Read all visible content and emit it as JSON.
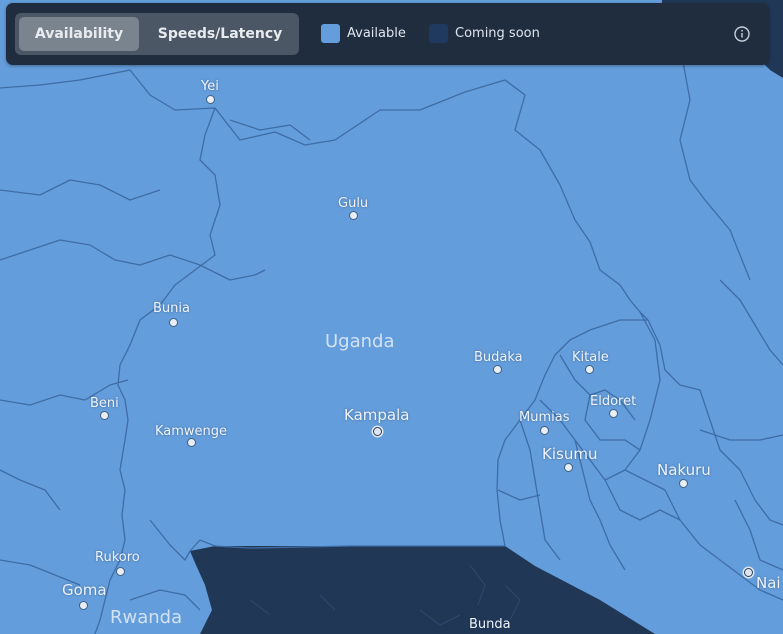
{
  "toolbar": {
    "tabs": [
      {
        "label": "Availability",
        "active": true
      },
      {
        "label": "Speeds/Latency",
        "active": false
      }
    ],
    "legend": [
      {
        "label": "Available",
        "color": "#649ddb"
      },
      {
        "label": "Coming soon",
        "color": "#1f3a5e"
      }
    ],
    "info_icon": "info-circle-icon"
  },
  "map": {
    "colors": {
      "available": "#649ddb",
      "coming_soon": "#213756",
      "border": "#3e6da6"
    },
    "countries": [
      {
        "name": "Uganda"
      },
      {
        "name": "Rwanda"
      }
    ],
    "cities": [
      {
        "name": "Yei",
        "capital": false
      },
      {
        "name": "Gulu",
        "capital": false
      },
      {
        "name": "Bunia",
        "capital": false
      },
      {
        "name": "Budaka",
        "capital": false
      },
      {
        "name": "Kitale",
        "capital": false
      },
      {
        "name": "Beni",
        "capital": false
      },
      {
        "name": "Eldoret",
        "capital": false
      },
      {
        "name": "Kampala",
        "capital": true
      },
      {
        "name": "Mumias",
        "capital": false
      },
      {
        "name": "Kamwenge",
        "capital": false
      },
      {
        "name": "Kisumu",
        "capital": false
      },
      {
        "name": "Nakuru",
        "capital": false
      },
      {
        "name": "Rukoro",
        "capital": false
      },
      {
        "name": "Goma",
        "capital": false
      },
      {
        "name": "Bunda",
        "capital": false
      },
      {
        "name": "Nai",
        "capital": true
      }
    ]
  }
}
